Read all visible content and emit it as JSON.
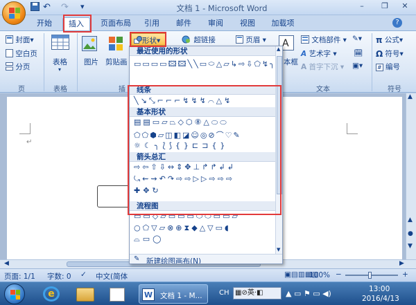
{
  "window": {
    "title": "文档 1 - Microsoft Word"
  },
  "quick_access": {
    "undo": "↶",
    "redo": "↷",
    "customize": "▾"
  },
  "window_controls": {
    "minimize": "–",
    "restore": "❐",
    "close": "✕"
  },
  "tabs": [
    "开始",
    "插入",
    "页面布局",
    "引用",
    "邮件",
    "审阅",
    "视图",
    "加载项"
  ],
  "ribbon": {
    "pages": {
      "cover": "封面",
      "blank": "空白页",
      "break": "分页",
      "label": "页"
    },
    "table": {
      "table": "表格",
      "label": "表格"
    },
    "illus": {
      "picture": "图片",
      "clipart": "剪贴画",
      "shapes": "形状",
      "label": "插"
    },
    "links": {
      "hyperlink": "超链接"
    },
    "header": {
      "header": "页眉"
    },
    "text": {
      "textbox": "本框",
      "docparts": "文档部件",
      "wordart": "艺术字",
      "dropcap": "首字下沉",
      "label": "文本"
    },
    "symbols": {
      "formula": "公式",
      "symbol": "符号",
      "number": "编号",
      "label": "符号"
    }
  },
  "gallery": {
    "cat_recent": "最近使用的形状",
    "cat_lines": "线条",
    "cat_basic": "基本形状",
    "cat_arrows": "箭头总汇",
    "cat_flow": "流程图",
    "footer_label": "新建绘图画布(N)",
    "recent_shapes": "▭▭▭▭🖾🖾╲╲▭⬭△▱↳⇨⇩⬠↯╮",
    "line_shapes": "╲↘⤡⌐⌐⌐↯↯↯⌒△↯",
    "basic_shapes_1": "▤▤▭▱⏢◇⬡⑧△⬭⬭",
    "basic_shapes_2": "⬠⬠⬢▱◫◧◪☺◎⊘⌒♡✎",
    "basic_shapes_3": "☼☾╮⟅⟆{}⊏⊐{}",
    "arrow_shapes_1": "⇨⇦⇧⇩⇔⇕✥⊥↱↱↲↲",
    "arrow_shapes_2": "⤿⇜⇝↶↷⇨⇨▷▷⇨⇨⇨",
    "arrow_shapes_3": "✚✥↻",
    "flow_shapes_1": "▭▭◇▱▭▭▭⬭⬭▭▭▱",
    "flow_shapes_2": "○⬠▽▱⊗⊕⧗◆△▽▭◖",
    "flow_shapes_3": "⌓▭◯"
  },
  "status": {
    "page": "页面: 1/1",
    "words": "字数: 0",
    "lang": "中文(简体",
    "zoom": "100%",
    "zoom_minus": "−",
    "zoom_plus": "+"
  },
  "taskbar": {
    "task_label": "文档 1 - M...",
    "ime": "CH",
    "ime_mode": "英",
    "time": "13:00",
    "date": "2016/4/13"
  },
  "colors": {
    "accent": "#15428b",
    "highlight": "#e23a3a"
  }
}
